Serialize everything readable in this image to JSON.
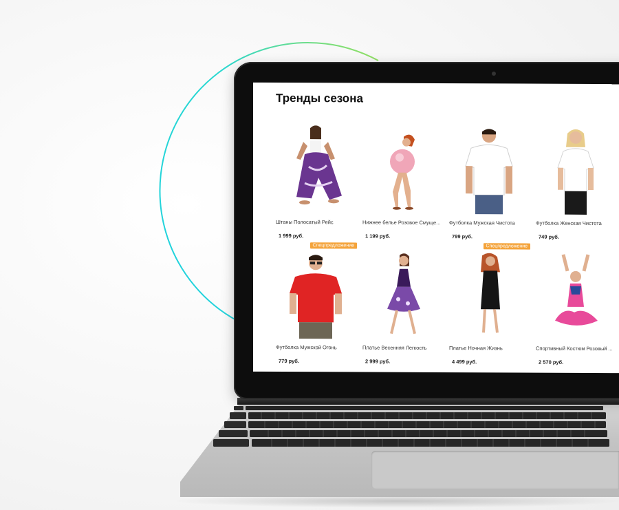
{
  "accent": {
    "arc_start": "#1fd1e0",
    "arc_end": "#9ae05a",
    "badge": "#f4a33a"
  },
  "screen": {
    "title": "Тренды сезона",
    "products": [
      {
        "name": "Штаны Полосатый Рейс",
        "price": "1 999 руб.",
        "badge": "",
        "figure": "woman-purple-pants"
      },
      {
        "name": "Нижнее белье Розовое Смуще...",
        "price": "1 199 руб.",
        "badge": "",
        "figure": "woman-pink-balloon"
      },
      {
        "name": "Футболка Мужская Чистота",
        "price": "799 руб.",
        "badge": "",
        "figure": "man-white-tshirt"
      },
      {
        "name": "Футболка Женская Чистота",
        "price": "749 руб.",
        "badge": "",
        "figure": "woman-white-tshirt"
      },
      {
        "name": "Футболка Мужской Огонь",
        "price": "779 руб.",
        "badge": "Спецпредложение",
        "figure": "man-red-tshirt"
      },
      {
        "name": "Платье Весенняя Легкость",
        "price": "2 999 руб.",
        "badge": "",
        "figure": "woman-purple-dress"
      },
      {
        "name": "Платье Ночная Жизнь",
        "price": "4 499 руб.",
        "badge": "Спецпредложение",
        "figure": "woman-black-dress"
      },
      {
        "name": "Спортивный Костюм Розовый ...",
        "price": "2 570 руб.",
        "badge": "",
        "figure": "woman-pink-sportsuit"
      }
    ]
  }
}
